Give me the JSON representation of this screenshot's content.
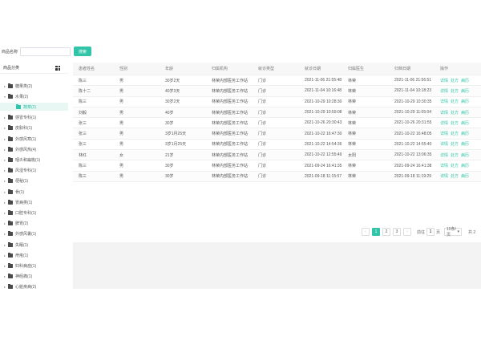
{
  "search": {
    "label": "商品名称",
    "placeholder": "",
    "value": "",
    "button": "搜索"
  },
  "sidebar": {
    "title": "商品分类",
    "grid_icon": "grid-icon",
    "items": [
      {
        "label": "糖果类(2)",
        "depth": 0
      },
      {
        "label": "水果(2)",
        "depth": 0,
        "expanded": true
      },
      {
        "label": "蔬菜(2)",
        "depth": 1,
        "selected": true
      },
      {
        "label": "感冒专科(1)",
        "depth": 0
      },
      {
        "label": "皮肤科(1)",
        "depth": 0
      },
      {
        "label": "外感风寒(1)",
        "depth": 0
      },
      {
        "label": "外感风热(4)",
        "depth": 0
      },
      {
        "label": "咽炎和扁桃(1)",
        "depth": 0
      },
      {
        "label": "风湿专科(1)",
        "depth": 0
      },
      {
        "label": "便秘(1)",
        "depth": 0
      },
      {
        "label": "骨(1)",
        "depth": 0
      },
      {
        "label": "胃病类(1)",
        "depth": 0
      },
      {
        "label": "口腔专科(1)",
        "depth": 0
      },
      {
        "label": "脾胃(2)",
        "depth": 0
      },
      {
        "label": "外感风暑(1)",
        "depth": 0
      },
      {
        "label": "失眠(1)",
        "depth": 0
      },
      {
        "label": "痔疮(1)",
        "depth": 0
      },
      {
        "label": "妇科病症(1)",
        "depth": 0
      },
      {
        "label": "神经痛(1)",
        "depth": 0
      },
      {
        "label": "心脏疾病(2)",
        "depth": 0
      }
    ]
  },
  "table": {
    "columns": [
      "患者姓名",
      "性别",
      "年龄",
      "归属机构",
      "就诊类型",
      "就诊日期",
      "归属医生",
      "归档日期",
      "操作"
    ],
    "actions": [
      "详情",
      "处方",
      "病历"
    ],
    "rows": [
      [
        "陈三",
        "男",
        "30岁2天",
        "林荣内部医务工作站",
        "门诊",
        "2021-11-06 21:55:48",
        "林荣",
        "2021-11-06 21:56:51"
      ],
      [
        "陈十二",
        "男",
        "40岁3天",
        "林荣内部医务工作站",
        "门诊",
        "2021-11-04 10:16:48",
        "林荣",
        "2021-11-04 10:18:23"
      ],
      [
        "陈三",
        "男",
        "30岁2天",
        "林荣内部医务工作站",
        "门诊",
        "2021-10-29 10:28:30",
        "林荣",
        "2021-10-29 10:30:35"
      ],
      [
        "刘毅",
        "男",
        "40岁",
        "林荣内部医务工作站",
        "门诊",
        "2021-10-29 10:59:08",
        "林荣",
        "2021-10-29 11:05:04"
      ],
      [
        "张三",
        "男",
        "30岁",
        "林荣内部医务工作站",
        "门诊",
        "2021-10-26 20:30:43",
        "林荣",
        "2021-10-26 20:31:55"
      ],
      [
        "张三",
        "男",
        "3岁1月25天",
        "林荣内部医务工作站",
        "门诊",
        "2021-10-22 16:47:30",
        "林荣",
        "2021-10-22 16:48:05"
      ],
      [
        "张三",
        "男",
        "3岁1月25天",
        "林荣内部医务工作站",
        "门诊",
        "2021-10-22 14:54:36",
        "林荣",
        "2021-10-22 14:55:40"
      ],
      [
        "林红",
        "女",
        "21岁",
        "林荣内部医务工作站",
        "门诊",
        "2021-10-22 12:55:49",
        "太阳",
        "2021-10-22 13:06:35"
      ],
      [
        "陈三",
        "男",
        "30岁",
        "林荣内部医务工作站",
        "门诊",
        "2021-09-24 16:41:35",
        "林荣",
        "2021-09-24 16:41:38"
      ],
      [
        "陈三",
        "男",
        "30岁",
        "林荣内部医务工作站",
        "门诊",
        "2021-09-18 11:15:57",
        "林荣",
        "2021-09-18 11:19:29"
      ]
    ]
  },
  "pagination": {
    "prev": "‹",
    "pages": [
      "1",
      "2",
      "3"
    ],
    "current": "1",
    "next": "›",
    "goto_label": "前往",
    "goto_value": "1",
    "goto_suffix": "页",
    "page_size": "10条/页",
    "total": "共 2"
  },
  "colors": {
    "accent": "#32c4a8"
  }
}
